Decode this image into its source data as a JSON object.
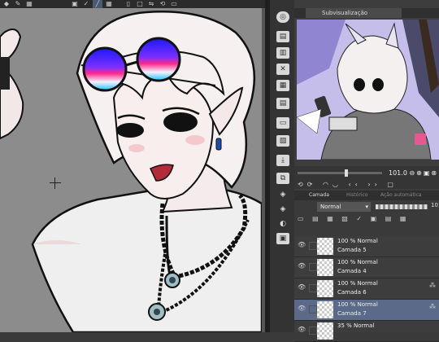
{
  "top_toolbar": {
    "icons": [
      "move-icon",
      "pen-icon",
      "brush-icon",
      "fill-icon",
      "phone-icon",
      "square-icon",
      "flip-icon",
      "rotate-icon"
    ]
  },
  "side_tools": {
    "icons": [
      "navigator-icon",
      "layer-property-icon",
      "tool-property-icon",
      "material-icon",
      "color-icon",
      "history-icon",
      "brush-size-icon",
      "download-icon",
      "copy-icon",
      "stack-icon",
      "clip-icon",
      "fill-icon",
      "panel-icon"
    ]
  },
  "subview": {
    "tab_label": "Subvisualização"
  },
  "navigator": {
    "zoom": "101.0",
    "zoom_fraction": 0.56
  },
  "layer_panel": {
    "tabs": [
      "Camada",
      "Histórico",
      "Ação automática"
    ],
    "blend_mode": "Normal",
    "opacity": "10"
  },
  "layers": [
    {
      "mode": "100 % Normal",
      "name": "Camada 5",
      "selected": false,
      "linked": false
    },
    {
      "mode": "100 % Normal",
      "name": "Camada 4",
      "selected": false,
      "linked": false
    },
    {
      "mode": "100 % Normal",
      "name": "Camada 6",
      "selected": false,
      "linked": true
    },
    {
      "mode": "100 % Normal",
      "name": "Camada 7",
      "selected": true,
      "linked": true
    },
    {
      "mode": "35 % Normal",
      "name": "",
      "selected": false,
      "linked": false
    }
  ],
  "colors": {
    "canvas_bg": "#8c8c8c",
    "panel_bg": "#3d3d3d",
    "selected_layer": "#5a6a88",
    "hair": "#f4eeee",
    "shirt": "#efefef"
  }
}
